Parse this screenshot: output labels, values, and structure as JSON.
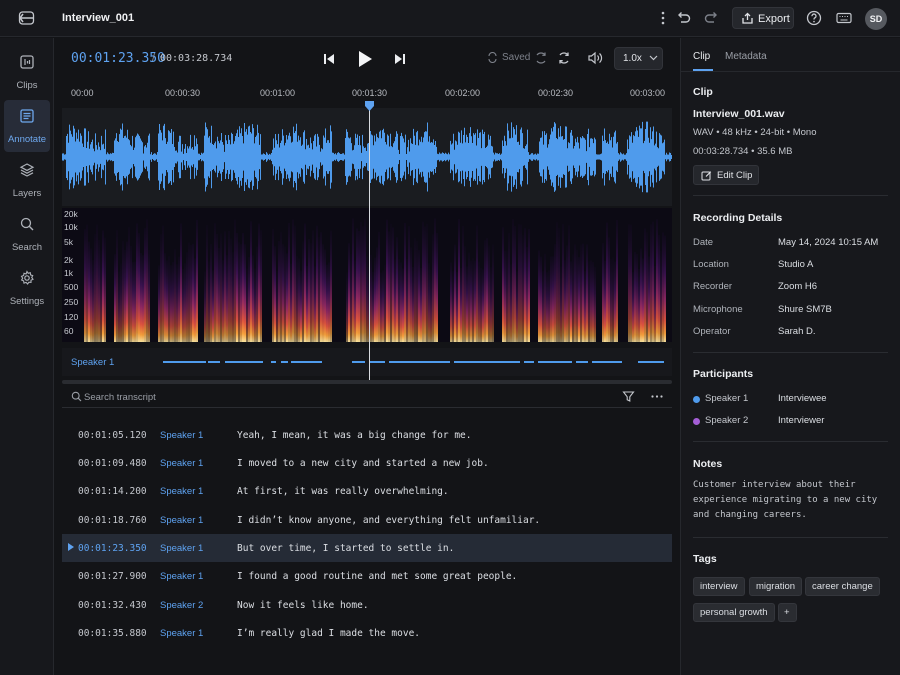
{
  "window": {
    "title": "Interview_001"
  },
  "toolbar": {
    "export_label": "Export",
    "avatar_initials": "SD"
  },
  "sidebar": {
    "items": [
      {
        "label": "Clips",
        "icon": "clips-icon"
      },
      {
        "label": "Annotate",
        "icon": "annotate-icon",
        "active": true
      },
      {
        "label": "Layers",
        "icon": "layers-icon"
      },
      {
        "label": "Search",
        "icon": "search-icon"
      },
      {
        "label": "Settings",
        "icon": "gear-icon"
      }
    ]
  },
  "transport": {
    "current_time": "00:01:23.350",
    "separator": "/",
    "total_time": "00:03:28.734",
    "saved_label": "Saved",
    "speed": "1.0x"
  },
  "timeline": {
    "ticks": [
      "00:00",
      "00:00:30",
      "00:01:00",
      "00:01:30",
      "00:02:00",
      "00:02:30",
      "00:03:00"
    ],
    "spectrogram_labels": [
      "20k",
      "10k",
      "5k",
      "2k",
      "1k",
      "500",
      "250",
      "120",
      "60"
    ],
    "speaker_lane": "Speaker 1"
  },
  "transcript": {
    "search_placeholder": "Search transcript",
    "rows": [
      {
        "time": "00:01:05.120",
        "speaker": "Speaker 1",
        "text": "Yeah, I mean, it was a big change for me."
      },
      {
        "time": "00:01:09.480",
        "speaker": "Speaker 1",
        "text": "I moved to a new city and started a new job."
      },
      {
        "time": "00:01:14.200",
        "speaker": "Speaker 1",
        "text": "At first, it was really overwhelming."
      },
      {
        "time": "00:01:18.760",
        "speaker": "Speaker 1",
        "text": "I didn’t know anyone, and everything felt unfamiliar."
      },
      {
        "time": "00:01:23.350",
        "speaker": "Speaker 1",
        "text": "But over time, I started to settle in.",
        "active": true
      },
      {
        "time": "00:01:27.900",
        "speaker": "Speaker 1",
        "text": "I found a good routine and met some great people."
      },
      {
        "time": "00:01:32.430",
        "speaker": "Speaker 2",
        "text": "Now it feels like home."
      },
      {
        "time": "00:01:35.880",
        "speaker": "Speaker 1",
        "text": "I’m really glad I made the move."
      }
    ]
  },
  "panel": {
    "tabs": [
      "Clip",
      "Metadata"
    ],
    "clip": {
      "heading": "Clip",
      "filename": "Interview_001.wav",
      "format": "WAV • 48 kHz • 24-bit • Mono",
      "duration_size": "00:03:28.734 • 35.6 MB",
      "edit_label": "Edit Clip"
    },
    "recording": {
      "heading": "Recording Details",
      "fields": [
        {
          "key": "Date",
          "value": "May 14, 2024  10:15 AM"
        },
        {
          "key": "Location",
          "value": "Studio A"
        },
        {
          "key": "Recorder",
          "value": "Zoom H6"
        },
        {
          "key": "Microphone",
          "value": "Shure SM7B"
        },
        {
          "key": "Operator",
          "value": "Sarah D."
        }
      ]
    },
    "participants": {
      "heading": "Participants",
      "items": [
        {
          "name": "Speaker 1",
          "role": "Interviewee",
          "color": "#4f9bec"
        },
        {
          "name": "Speaker 2",
          "role": "Interviewer",
          "color": "#a45ed6"
        }
      ]
    },
    "notes": {
      "heading": "Notes",
      "text": "Customer interview about their experience migrating to a new city and changing careers."
    },
    "tags": {
      "heading": "Tags",
      "items": [
        "interview",
        "migration",
        "career change",
        "personal growth"
      ],
      "add_label": "+"
    }
  },
  "colors": {
    "accent": "#5ea2f0",
    "waveform": "#4f9bec",
    "speaker2": "#a45ed6"
  }
}
